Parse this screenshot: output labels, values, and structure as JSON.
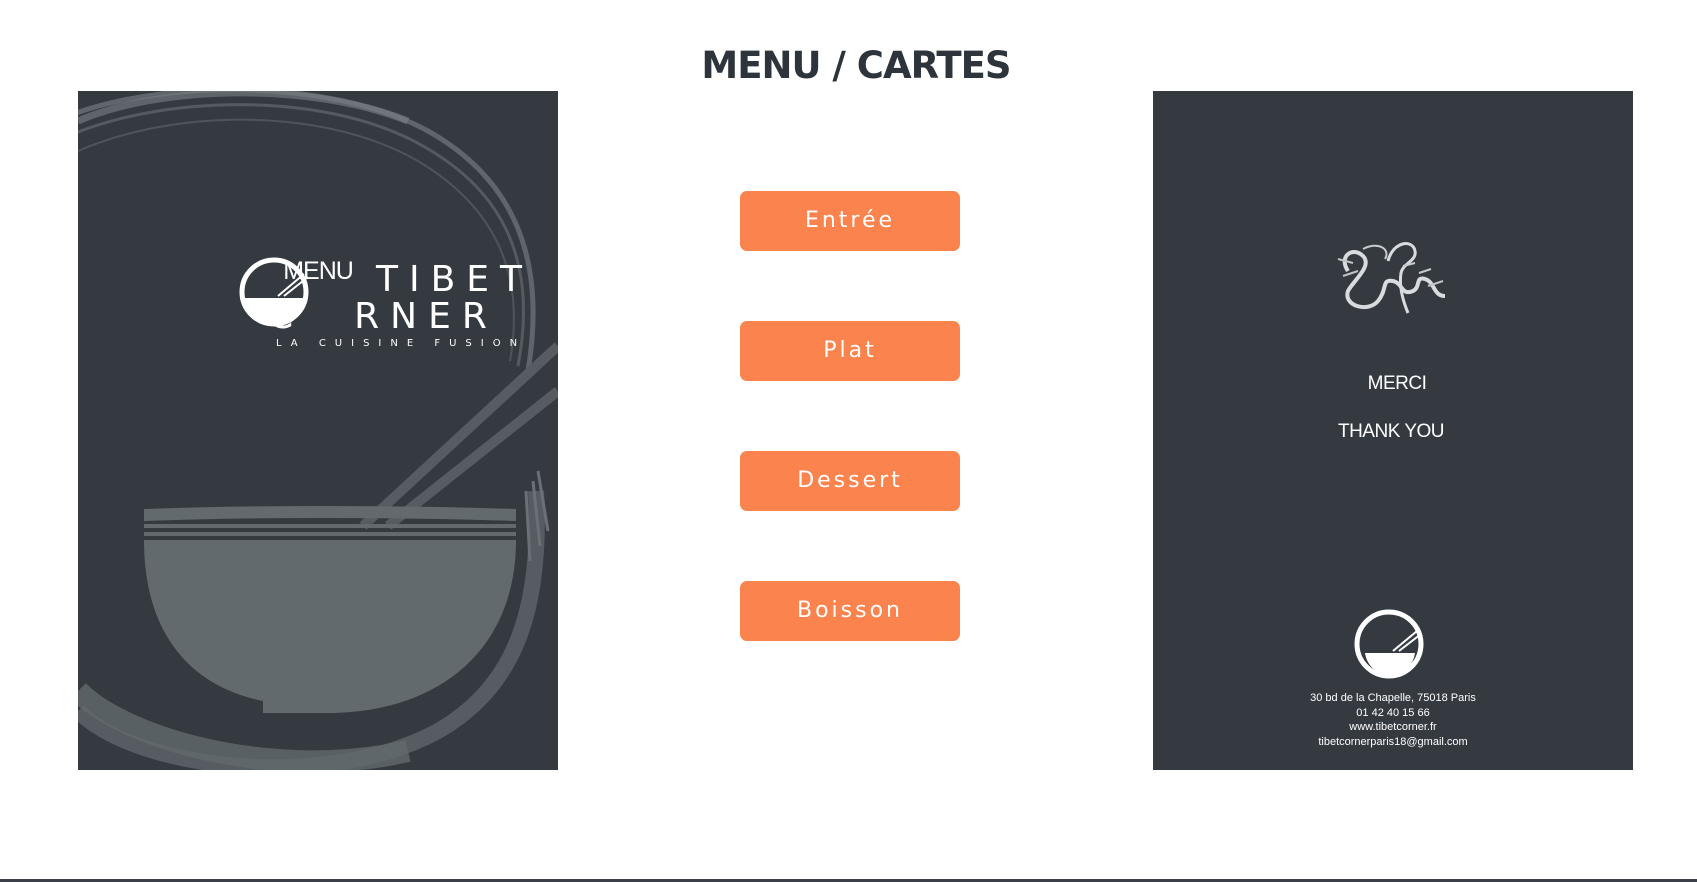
{
  "page": {
    "title": "MENU / CARTES"
  },
  "front_card": {
    "label": "MENU",
    "brand_top": "TIBET",
    "brand_bottom_first": "C",
    "brand_bottom_rest": "RNER",
    "tagline": "LA CUISINE FUSION"
  },
  "buttons": [
    {
      "label": "Entrée"
    },
    {
      "label": "Plat"
    },
    {
      "label": "Dessert"
    },
    {
      "label": "Boisson"
    }
  ],
  "back_card": {
    "merci": "MERCI",
    "thank_you": "THANK YOU",
    "address": "30 bd de la Chapelle, 75018 Paris",
    "phone": "01 42 40 15 66",
    "website": "www.tibetcorner.fr",
    "email": "tibetcornerparis18@gmail.com"
  },
  "colors": {
    "accent": "#fa834e",
    "card_bg": "#353a41",
    "title": "#2e343b"
  }
}
